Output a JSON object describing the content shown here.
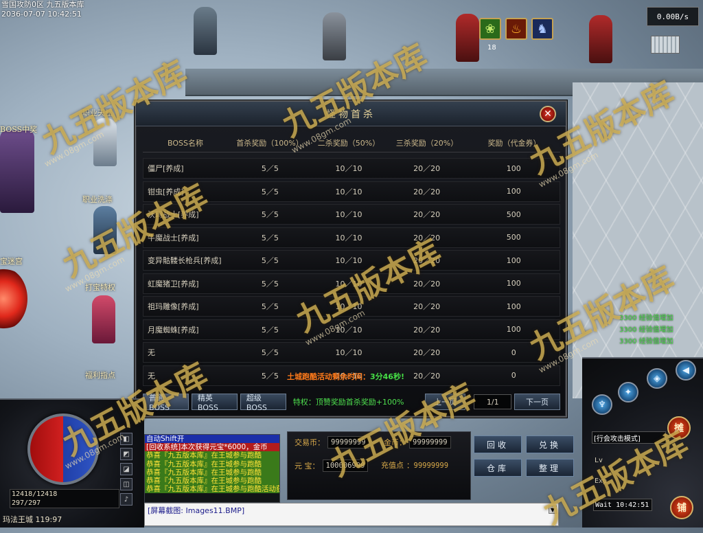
{
  "top_info": {
    "server_line": "雪国攻防0区 九五版本库",
    "datetime": "2036-07-07 10:42:51"
  },
  "network": {
    "speed": "0.00B/s"
  },
  "skills": {
    "icons": [
      "leaf-icon",
      "fire-icon",
      "wolf-icon"
    ],
    "count": "18"
  },
  "npc_labels": [
    "职业天赋",
    "BOSS中奖",
    "职业洗涤",
    "打宝特权",
    "福利指点",
    "宝迷宫"
  ],
  "dialog": {
    "title": "怪物首杀",
    "close_glyph": "✕",
    "headers": [
      "BOSS名称",
      "首杀奖励（100%）",
      "二杀奖励（50%）",
      "三杀奖励（20%）",
      "奖励（代金券）"
    ],
    "rows": [
      {
        "name": "僵尸[养成]",
        "first": "5／5",
        "second": "10／10",
        "third": "20／20",
        "reward": "100"
      },
      {
        "name": "钳虫[养成]",
        "first": "5／5",
        "second": "10／10",
        "third": "20／20",
        "reward": "100"
      },
      {
        "name": "沃玛战士[养成]",
        "first": "5／5",
        "second": "10／10",
        "third": "20／20",
        "reward": "500"
      },
      {
        "name": "牛魔战士[养成]",
        "first": "5／5",
        "second": "10／10",
        "third": "20／20",
        "reward": "500"
      },
      {
        "name": "变异骷髅长枪兵[养成]",
        "first": "5／5",
        "second": "10／10",
        "third": "20／20",
        "reward": "100"
      },
      {
        "name": "虹魔猪卫[养成]",
        "first": "5／5",
        "second": "10／10",
        "third": "20／20",
        "reward": "100"
      },
      {
        "name": "祖玛雕像[养成]",
        "first": "5／5",
        "second": "10／10",
        "third": "20／20",
        "reward": "100"
      },
      {
        "name": "月魔蜘蛛[养成]",
        "first": "5／5",
        "second": "10／10",
        "third": "20／20",
        "reward": "100"
      },
      {
        "name": "无",
        "first": "5／5",
        "second": "10／10",
        "third": "20／20",
        "reward": "0"
      },
      {
        "name": "无",
        "first": "5／5",
        "second": "10／10",
        "third": "20／20",
        "reward": "0"
      }
    ],
    "countdown_label": "土城跑酷活动剩余时间：",
    "countdown_time": "3分46秒!",
    "tabs": [
      "普通BOSS",
      "精英BOSS",
      "超级BOSS"
    ],
    "privilege": "特权：顶赞奖励首杀奖励+100%",
    "prev_label": "上一页",
    "page": "1/1",
    "next_label": "下一页"
  },
  "player": {
    "hp": "12418/12418",
    "mp": "297/297",
    "location": "玛法王城  119:97"
  },
  "chat": {
    "lines": [
      {
        "text": "自动Shift开",
        "color": "#ffffff",
        "bg": "#1b2ea8"
      },
      {
        "text": "[回收系统]本次获得元宝*6000，金币",
        "color": "#ffffff",
        "bg": "#b21c1c"
      },
      {
        "text": "恭喜『九五版本库』在王城参与跑酷",
        "color": "#ffe33a",
        "bg": "#3a7a1a"
      },
      {
        "text": "恭喜『九五版本库』在王城参与跑酷",
        "color": "#ffe33a",
        "bg": "#3a7a1a"
      },
      {
        "text": "恭喜『九五版本库』在王城参与跑酷",
        "color": "#ffe33a",
        "bg": "#3a7a1a"
      },
      {
        "text": "恭喜『九五版本库』在王城参与跑酷",
        "color": "#ffe33a",
        "bg": "#3a7a1a"
      },
      {
        "text": "恭喜『九五版本库』在王城参与跑酷活动获得宝物：幸运宝石",
        "color": "#ffe33a",
        "bg": "#3a7a1a"
      }
    ],
    "input_text": "[屏幕截图: Images11.BMP]"
  },
  "currency": {
    "trade_label": "交易币：",
    "trade_value": "99999999",
    "gold_label": "金币：",
    "gold_value": "99999999",
    "yuanbao_label": "元  宝：",
    "yuanbao_value": "100006999",
    "recharge_label": "充值点",
    "recharge_value": "：99999999"
  },
  "actions": [
    "回收",
    "兑换",
    "仓库",
    "整理"
  ],
  "right_hud": {
    "mode": "[行会攻击模式]",
    "clock": "Wait 10:42:51",
    "shop_label": "铺",
    "stall_label": "摊",
    "skill_glyphs": [
      "♆",
      "✦",
      "◈",
      "◀"
    ]
  },
  "exp_messages": [
    "3300 经验值增加",
    "3300 经验值增加",
    "3300 经验值增加"
  ],
  "watermark": {
    "text": "九五版本库",
    "url": "www.08gm.com"
  },
  "colors": {
    "accent_gold": "#d8a94a",
    "positive_green": "#46e046",
    "warning_orange": "#ff7a1a",
    "close_red": "#d83a2a"
  }
}
